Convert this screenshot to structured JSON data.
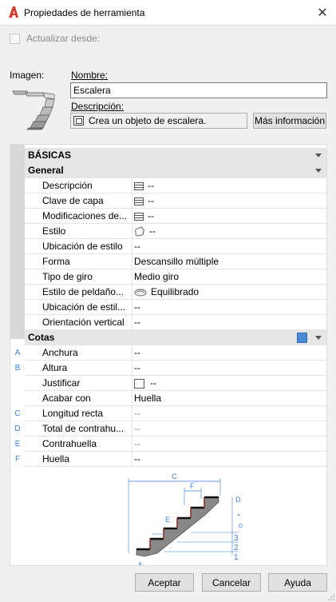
{
  "window": {
    "title": "Propiedades de herramienta",
    "close_glyph": "✕"
  },
  "update_from": {
    "label": "Actualizar desde:",
    "checked": false
  },
  "image_label": "Imagen:",
  "name": {
    "label": "Nombre:",
    "value": "Escalera"
  },
  "description": {
    "label": "Descripción:",
    "value": "Crea un objeto de escalera.",
    "more_info_label": "Más información"
  },
  "sections": {
    "basicas": "BÁSICAS",
    "general": "General",
    "cotas": "Cotas"
  },
  "general_rows": [
    {
      "name": "Descripción",
      "value": "--",
      "icon": "table-icon"
    },
    {
      "name": "Clave de capa",
      "value": "--",
      "icon": "table-icon"
    },
    {
      "name": "Modificaciones de...",
      "value": "--",
      "icon": "table-icon"
    },
    {
      "name": "Estilo",
      "value": "--",
      "icon": "hand-icon"
    },
    {
      "name": "Ubicación de estilo",
      "value": "--",
      "icon": ""
    },
    {
      "name": "Forma",
      "value": "Descansillo múltiple",
      "icon": ""
    },
    {
      "name": "Tipo de giro",
      "value": "Medio giro",
      "icon": ""
    },
    {
      "name": "Estilo de peldaño...",
      "value": "Equilibrado",
      "icon": "cloud-icon"
    },
    {
      "name": "Ubicación de estil...",
      "value": "--",
      "icon": ""
    },
    {
      "name": "Orientación vertical",
      "value": "--",
      "icon": ""
    }
  ],
  "cotas_rows": [
    {
      "letter": "A",
      "name": "Anchura",
      "value": "--",
      "dim": false,
      "icon": ""
    },
    {
      "letter": "B",
      "name": "Altura",
      "value": "--",
      "dim": false,
      "icon": ""
    },
    {
      "letter": "",
      "name": "Justificar",
      "value": "--",
      "dim": false,
      "icon": "square-icon"
    },
    {
      "letter": "",
      "name": "Acabar con",
      "value": "Huella",
      "dim": false,
      "icon": ""
    },
    {
      "letter": "C",
      "name": "Longitud recta",
      "value": "--",
      "dim": true,
      "icon": ""
    },
    {
      "letter": "D",
      "name": "Total de contrahu...",
      "value": "--",
      "dim": true,
      "icon": ""
    },
    {
      "letter": "E",
      "name": "Contrahuella",
      "value": "--",
      "dim": true,
      "icon": ""
    },
    {
      "letter": "F",
      "name": "Huella",
      "value": "--",
      "dim": false,
      "icon": ""
    }
  ],
  "diagram_labels": {
    "c": "C",
    "f": "F",
    "e": "E",
    "d_top": "D",
    "d_mid": "D",
    "n3": "3",
    "n2": "2",
    "n1": "1",
    "a": "A"
  },
  "buttons": {
    "ok": "Aceptar",
    "cancel": "Cancelar",
    "help": "Ayuda"
  },
  "colors": {
    "accent_letters": "#3b7fd1",
    "app_icon": "#d63a2f"
  }
}
